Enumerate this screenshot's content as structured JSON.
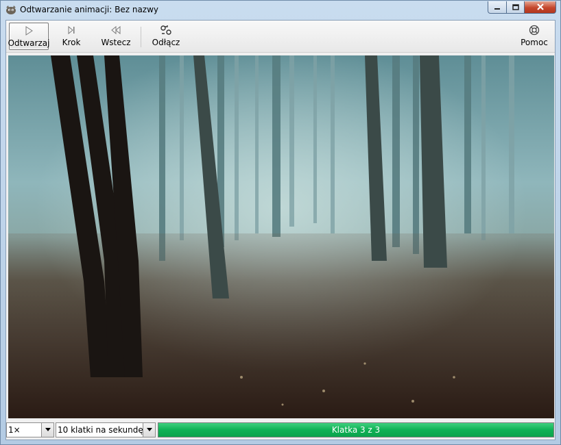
{
  "window": {
    "title": "Odtwarzanie animacji: Bez nazwy"
  },
  "toolbar": {
    "play_label": "Odtwarzaj",
    "step_label": "Krok",
    "rewind_label": "Wstecz",
    "detach_label": "Odłącz",
    "help_label": "Pomoc"
  },
  "statusbar": {
    "zoom_value": "1×",
    "fps_value": "10 klatki na sekundę",
    "frame_text": "Klatka 3 z 3",
    "progress_fraction": 1.0
  },
  "colors": {
    "progress": "#0fb155"
  },
  "icons": [
    "gimp-icon",
    "minimize-icon",
    "maximize-icon",
    "close-icon",
    "play-icon",
    "step-icon",
    "rewind-icon",
    "detach-icon",
    "help-icon",
    "dropdown-arrow-icon"
  ]
}
